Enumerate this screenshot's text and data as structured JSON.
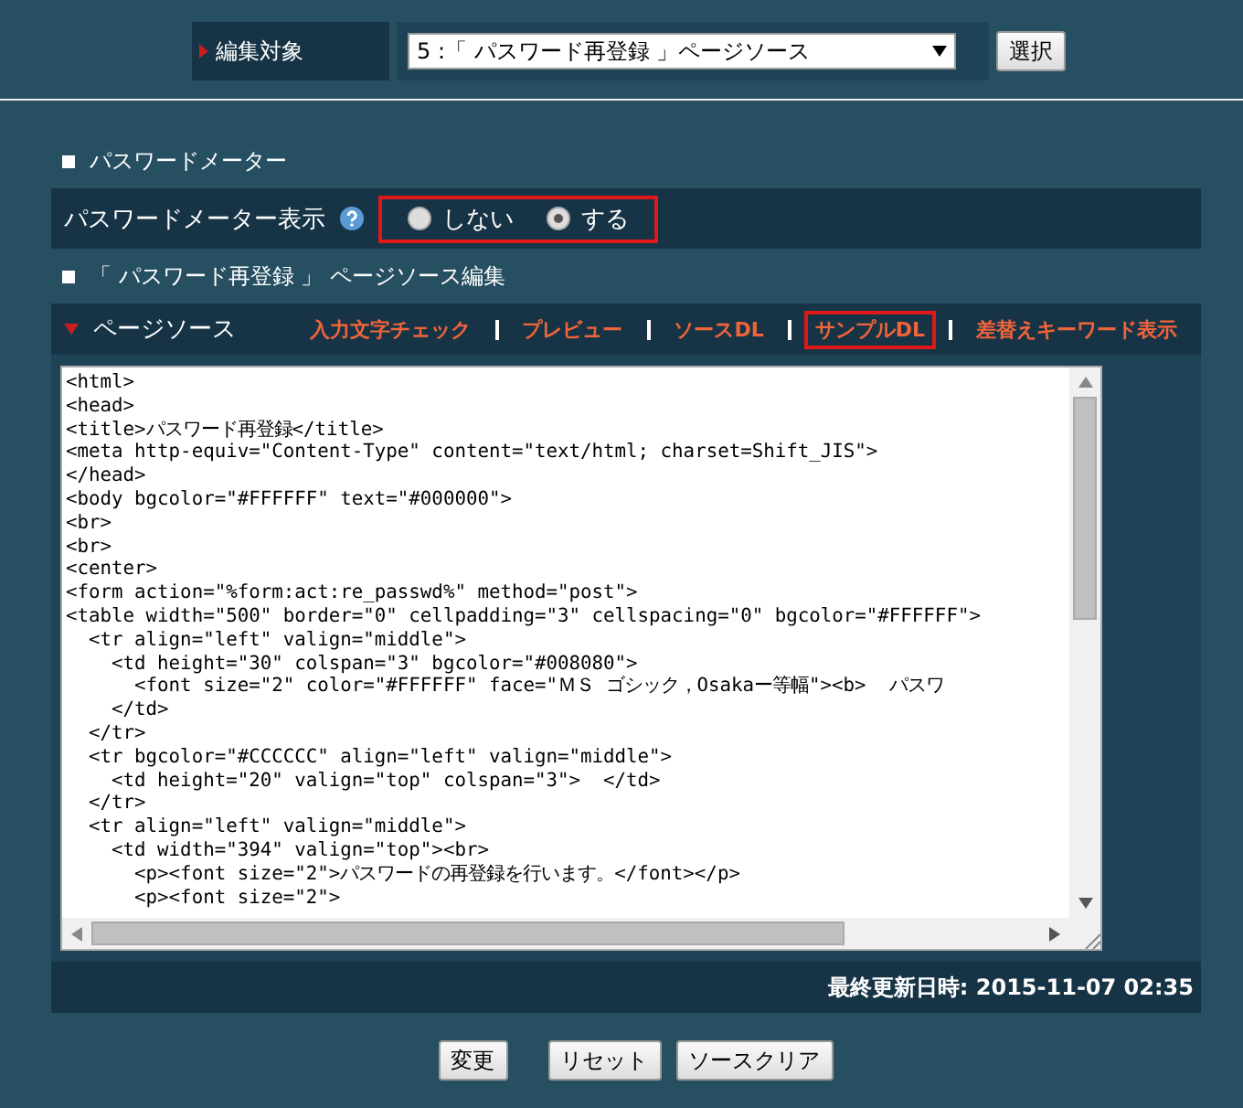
{
  "target": {
    "label": "編集対象",
    "value": "5 :「 パスワード再登録 」ページソース",
    "button": "選択"
  },
  "meter_section": {
    "heading": "パスワードメーター",
    "label": "パスワードメーター表示",
    "highlighted": true,
    "options": [
      {
        "label": "しない",
        "selected": false
      },
      {
        "label": "する",
        "selected": true
      }
    ]
  },
  "source_section": {
    "heading": "「 パスワード再登録 」 ページソース編集",
    "panel_title": "ページソース",
    "links": [
      {
        "label": "入力文字チェック",
        "highlighted": false
      },
      {
        "label": "プレビュー",
        "highlighted": false
      },
      {
        "label": "ソースDL",
        "highlighted": false
      },
      {
        "label": "サンプルDL",
        "highlighted": true
      },
      {
        "label": "差替えキーワード表示",
        "highlighted": false
      }
    ],
    "code_lines": [
      "<html>",
      "<head>",
      "<title>パスワード再登録</title>",
      "<meta http-equiv=\"Content-Type\" content=\"text/html; charset=Shift_JIS\">",
      "</head>",
      "<body bgcolor=\"#FFFFFF\" text=\"#000000\">",
      "<br>",
      "<br>",
      "<center>",
      "<form action=\"%form:act:re_passwd%\" method=\"post\">",
      "<table width=\"500\" border=\"0\" cellpadding=\"3\" cellspacing=\"0\" bgcolor=\"#FFFFFF\">",
      "  <tr align=\"left\" valign=\"middle\">",
      "    <td height=\"30\" colspan=\"3\" bgcolor=\"#008080\">",
      "      <font size=\"2\" color=\"#FFFFFF\" face=\"ＭＳ ゴシック，Osakaー等幅\"><b>  パスワ",
      "    </td>",
      "  </tr>",
      "  <tr bgcolor=\"#CCCCCC\" align=\"left\" valign=\"middle\">",
      "    <td height=\"20\" valign=\"top\" colspan=\"3\">  </td>",
      "  </tr>",
      "  <tr align=\"left\" valign=\"middle\">",
      "    <td width=\"394\" valign=\"top\"><br>",
      "      <p><font size=\"2\">パスワードの再登録を行います。</font></p>",
      "      <p><font size=\"2\">"
    ],
    "updated": "最終更新日時: 2015-11-07 02:35"
  },
  "buttons": [
    "変更",
    "リセット",
    "ソースクリア"
  ]
}
